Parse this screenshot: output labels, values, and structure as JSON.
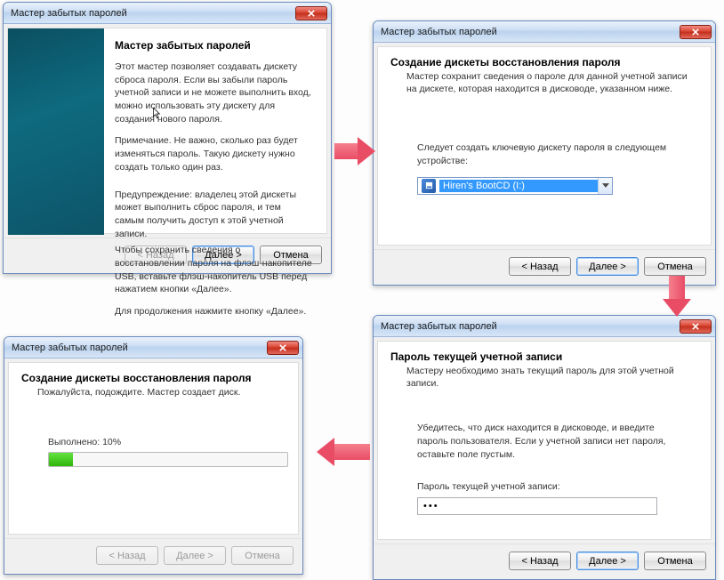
{
  "common_title": "Мастер забытых паролей",
  "btn_back": "< Назад",
  "btn_next": "Далее >",
  "btn_cancel": "Отмена",
  "d1": {
    "heading": "Мастер забытых паролей",
    "p1": "Этот мастер позволяет создавать дискету сброса пароля. Если вы забыли пароль учетной записи и не можете выполнить вход, можно использовать эту дискету для создания нового пароля.",
    "p2": "Примечание. Не важно, сколько раз будет изменяться пароль. Такую дискету нужно создать только один раз.",
    "p3": "Предупреждение: владелец этой дискеты может выполнить сброс пароля, и тем самым получить доступ к этой учетной записи.",
    "p4": "Чтобы сохранить сведения о восстановлении пароля на флэш-накопителе USB, вставьте флэш-накопитель USB перед нажатием кнопки «Далее».",
    "p5": "Для продолжения нажмите кнопку «Далее»."
  },
  "d2": {
    "heading": "Создание дискеты восстановления пароля",
    "sub": "Мастер сохранит сведения о пароле для данной учетной записи на дискете, которая находится в дисководе, указанном ниже.",
    "label": "Следует создать ключевую дискету пароля в следующем устройстве:",
    "drive": "Hiren's BootCD (I:)"
  },
  "d3": {
    "heading": "Пароль текущей учетной записи",
    "sub": "Мастеру необходимо знать текущий пароль для этой учетной записи.",
    "hint": "Убедитесь, что диск находится в дисководе, и введите пароль пользователя. Если у учетной записи нет пароля, оставьте поле пустым.",
    "label": "Пароль текущей учетной записи:",
    "value": "●●●"
  },
  "d4": {
    "heading": "Создание дискеты восстановления пароля",
    "sub": "Пожалуйста, подождите. Мастер создает диск.",
    "progress_label": "Выполнено: 10%",
    "progress_value": 10
  }
}
